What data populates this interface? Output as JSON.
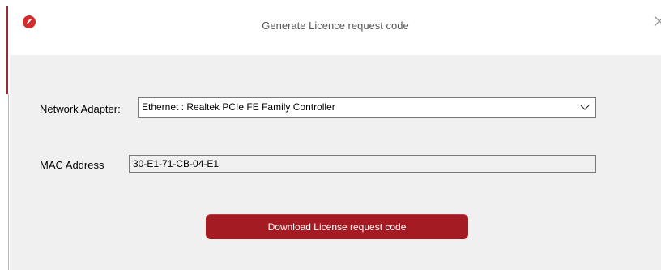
{
  "window": {
    "title": "Generate Licence request code",
    "close_symbol": "×",
    "app_icon": "app-logo-icon",
    "close_icon": "close-icon"
  },
  "form": {
    "network_adapter_label": "Network Adapter:",
    "network_adapter_value": "Ethernet : Realtek PCIe FE Family Controller",
    "dropdown_icon": "chevron-down-icon",
    "mac_label": "MAC Address",
    "mac_value": "30-E1-71-CB-04-E1"
  },
  "actions": {
    "download_label": "Download License request code"
  },
  "colors": {
    "accent": "#a51b24",
    "titlebar": "#ffffff",
    "body": "#f0f0f0"
  }
}
